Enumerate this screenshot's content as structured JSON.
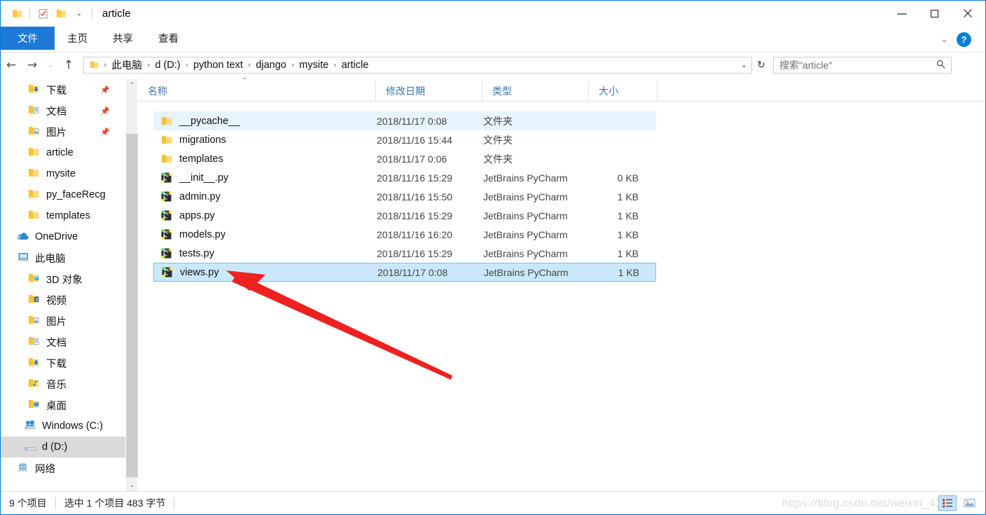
{
  "window": {
    "title": "article",
    "minimize_label": "—",
    "maximize_label": "☐",
    "close_label": "✕",
    "collapse_ribbon_label": "⌄",
    "help_label": "?"
  },
  "quick_access": {
    "folder_icon": "folder-icon",
    "properties_icon": "properties-checkbox-icon",
    "new_folder_icon": "new-folder-icon",
    "dropdown_label": "⌄"
  },
  "ribbon": {
    "tabs": [
      {
        "label": "文件",
        "active": true
      },
      {
        "label": "主页",
        "active": false
      },
      {
        "label": "共享",
        "active": false
      },
      {
        "label": "查看",
        "active": false
      }
    ],
    "accent_color": "#1e7ad4"
  },
  "navigation": {
    "back_label": "←",
    "forward_label": "→",
    "recent_label": "⌄",
    "up_label": "↑",
    "refresh_label": "↻",
    "address_dropdown_label": "⌄",
    "breadcrumbs": [
      "此电脑",
      "d (D:)",
      "python text",
      "django",
      "mysite",
      "article"
    ],
    "crumb_separator": "›"
  },
  "search": {
    "placeholder": "搜索\"article\"",
    "icon": "search-icon"
  },
  "sidebar": {
    "items": [
      {
        "label": "下载",
        "icon": "downloads-folder-icon",
        "indent": 38,
        "pinned": true,
        "selected": false
      },
      {
        "label": "文档",
        "icon": "documents-folder-icon",
        "indent": 38,
        "pinned": true,
        "selected": false
      },
      {
        "label": "图片",
        "icon": "pictures-folder-icon",
        "indent": 38,
        "pinned": true,
        "selected": false
      },
      {
        "label": "article",
        "icon": "folder-icon",
        "indent": 38,
        "pinned": false,
        "selected": false
      },
      {
        "label": "mysite",
        "icon": "folder-icon",
        "indent": 38,
        "pinned": false,
        "selected": false
      },
      {
        "label": "py_faceRecg",
        "icon": "folder-icon",
        "indent": 38,
        "pinned": false,
        "selected": false
      },
      {
        "label": "templates",
        "icon": "folder-icon",
        "indent": 38,
        "pinned": false,
        "selected": false
      },
      {
        "label": "OneDrive",
        "icon": "onedrive-cloud-icon",
        "indent": 22,
        "pinned": false,
        "selected": false
      },
      {
        "label": "此电脑",
        "icon": "this-pc-icon",
        "indent": 22,
        "pinned": false,
        "selected": false
      },
      {
        "label": "3D 对象",
        "icon": "3d-objects-icon",
        "indent": 38,
        "pinned": false,
        "selected": false
      },
      {
        "label": "视频",
        "icon": "videos-folder-icon",
        "indent": 38,
        "pinned": false,
        "selected": false
      },
      {
        "label": "图片",
        "icon": "pictures-folder-icon",
        "indent": 38,
        "pinned": false,
        "selected": false
      },
      {
        "label": "文档",
        "icon": "documents-folder-icon",
        "indent": 38,
        "pinned": false,
        "selected": false
      },
      {
        "label": "下载",
        "icon": "downloads-folder-icon",
        "indent": 38,
        "pinned": false,
        "selected": false
      },
      {
        "label": "音乐",
        "icon": "music-folder-icon",
        "indent": 38,
        "pinned": false,
        "selected": false
      },
      {
        "label": "桌面",
        "icon": "desktop-folder-icon",
        "indent": 38,
        "pinned": false,
        "selected": false
      },
      {
        "label": "Windows (C:)",
        "icon": "windows-drive-icon",
        "indent": 32,
        "pinned": false,
        "selected": false
      },
      {
        "label": "d (D:)",
        "icon": "drive-icon",
        "indent": 32,
        "pinned": false,
        "selected": true
      },
      {
        "label": "网络",
        "icon": "network-icon",
        "indent": 22,
        "pinned": false,
        "selected": false
      }
    ],
    "scroll_up_label": "⌃",
    "scroll_down_label": "⌄"
  },
  "file_list": {
    "columns": [
      {
        "key": "name",
        "label": "名称",
        "sorted": "asc",
        "sort_caret": "⌃"
      },
      {
        "key": "date",
        "label": "修改日期",
        "sorted": "",
        "sort_caret": ""
      },
      {
        "key": "type",
        "label": "类型",
        "sorted": "",
        "sort_caret": ""
      },
      {
        "key": "size",
        "label": "大小",
        "sorted": "",
        "sort_caret": ""
      }
    ],
    "rows": [
      {
        "name": "__pycache__",
        "date": "2018/11/17 0:08",
        "type": "文件夹",
        "size": "",
        "icon": "folder-icon",
        "state": "hover"
      },
      {
        "name": "migrations",
        "date": "2018/11/16 15:44",
        "type": "文件夹",
        "size": "",
        "icon": "folder-icon",
        "state": ""
      },
      {
        "name": "templates",
        "date": "2018/11/17 0:06",
        "type": "文件夹",
        "size": "",
        "icon": "folder-icon",
        "state": ""
      },
      {
        "name": "__init__.py",
        "date": "2018/11/16 15:29",
        "type": "JetBrains PyCharm",
        "size": "0 KB",
        "icon": "pycharm-file-icon",
        "state": ""
      },
      {
        "name": "admin.py",
        "date": "2018/11/16 15:50",
        "type": "JetBrains PyCharm",
        "size": "1 KB",
        "icon": "pycharm-file-icon",
        "state": ""
      },
      {
        "name": "apps.py",
        "date": "2018/11/16 15:29",
        "type": "JetBrains PyCharm",
        "size": "1 KB",
        "icon": "pycharm-file-icon",
        "state": ""
      },
      {
        "name": "models.py",
        "date": "2018/11/16 16:20",
        "type": "JetBrains PyCharm",
        "size": "1 KB",
        "icon": "pycharm-file-icon",
        "state": ""
      },
      {
        "name": "tests.py",
        "date": "2018/11/16 15:29",
        "type": "JetBrains PyCharm",
        "size": "1 KB",
        "icon": "pycharm-file-icon",
        "state": ""
      },
      {
        "name": "views.py",
        "date": "2018/11/17 0:08",
        "type": "JetBrains PyCharm",
        "size": "1 KB",
        "icon": "pycharm-file-icon",
        "state": "selected"
      }
    ],
    "selection_color": "#cbe8fa",
    "hover_color": "#e7f3fd"
  },
  "status_bar": {
    "item_count": "9 个项目",
    "selection_info": "选中 1 个项目  483 字节",
    "details_view_icon": "details-view-icon",
    "large_icons_view_icon": "large-icons-view-icon"
  },
  "watermark": {
    "text": "https://blog.csdn.net/weixin_41"
  },
  "annotation": {
    "arrow_color": "#ef2020",
    "arrow_name": "red-pointer-arrow"
  }
}
